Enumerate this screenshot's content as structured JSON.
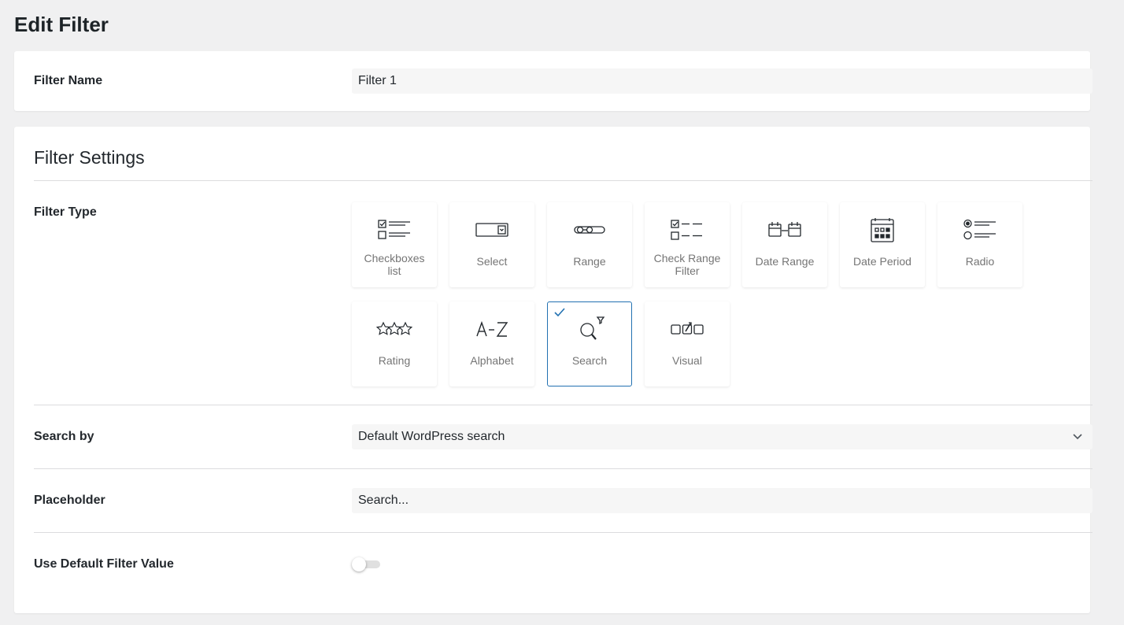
{
  "page": {
    "title": "Edit Filter"
  },
  "filter_name": {
    "label": "Filter Name",
    "value": "Filter 1"
  },
  "settings": {
    "title": "Filter Settings",
    "filter_type_label": "Filter Type",
    "selected_type": "Search",
    "types": [
      {
        "label": "Checkboxes list",
        "icon": "checkboxes-list-icon"
      },
      {
        "label": "Select",
        "icon": "select-dropdown-icon"
      },
      {
        "label": "Range",
        "icon": "range-slider-icon"
      },
      {
        "label": "Check Range Filter",
        "icon": "check-range-icon"
      },
      {
        "label": "Date Range",
        "icon": "date-range-icon"
      },
      {
        "label": "Date Period",
        "icon": "calendar-icon"
      },
      {
        "label": "Radio",
        "icon": "radio-list-icon"
      },
      {
        "label": "Rating",
        "icon": "stars-icon"
      },
      {
        "label": "Alphabet",
        "icon": "alphabet-az-icon"
      },
      {
        "label": "Search",
        "icon": "search-filter-icon"
      },
      {
        "label": "Visual",
        "icon": "visual-icon"
      }
    ],
    "search_by": {
      "label": "Search by",
      "value": "Default WordPress search"
    },
    "placeholder": {
      "label": "Placeholder",
      "value": "Search..."
    },
    "use_default": {
      "label": "Use Default Filter Value",
      "enabled": false
    }
  },
  "colors": {
    "accent": "#2271b1",
    "background": "#f0f0f1",
    "input_bg": "#f6f6f6"
  }
}
